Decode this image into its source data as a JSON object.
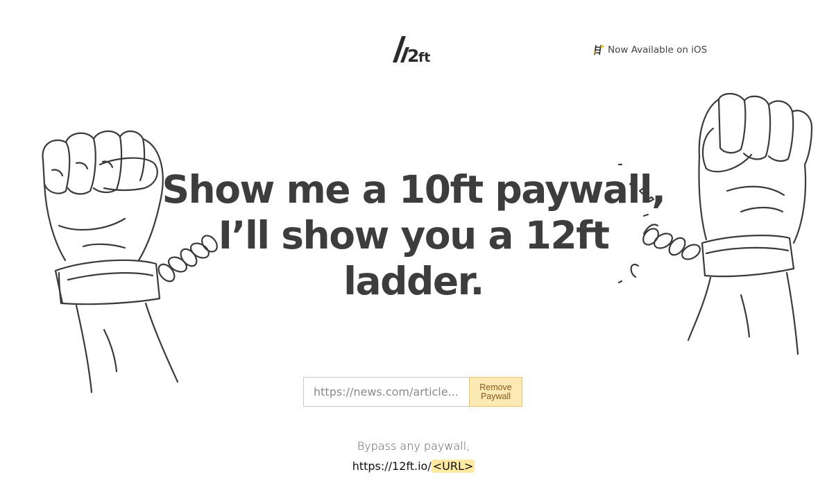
{
  "header": {
    "logo_text": "12ft",
    "ios_link": "Now Available on iOS",
    "ios_icon": "ladder-sparkle-icon"
  },
  "hero": {
    "headline": "Show me a 10ft paywall, I’ll show you a 12ft ladder."
  },
  "form": {
    "placeholder": "https://news.com/article...",
    "button_label": "Remove\nPaywall"
  },
  "footer": {
    "tagline": "Bypass any paywall,",
    "url_prefix": "https://12ft.io/",
    "url_token": "<URL>"
  },
  "colors": {
    "button_bg": "#fde9b3",
    "button_text": "#8a5a1c",
    "headline": "#3d3d3d",
    "highlight": "#fde9a0"
  }
}
